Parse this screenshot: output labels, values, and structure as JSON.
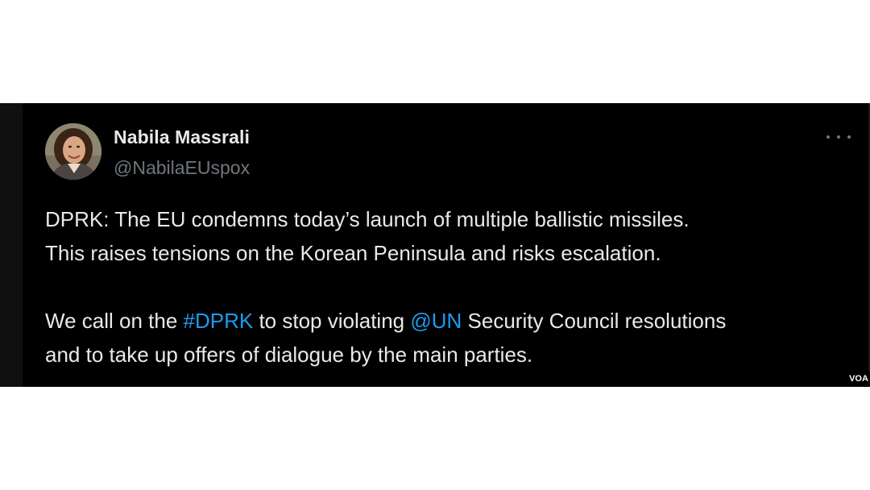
{
  "author": {
    "display_name": "Nabila Massrali",
    "handle": "@NabilaEUspox",
    "avatar_icon": "profile-photo"
  },
  "menu": {
    "icon": "more-horizontal-icon"
  },
  "tweet": {
    "line1": "DPRK: The EU condemns today’s launch of multiple ballistic missiles.",
    "line2": "This raises tensions on the Korean Peninsula and risks escalation.",
    "line3_part1": "We call on the ",
    "hashtag": "#DPRK",
    "line3_part2": " to stop violating ",
    "mention": "@UN",
    "line3_part3": " Security Council resolutions",
    "line4": "and to take up offers of dialogue by the main parties."
  },
  "watermark": {
    "label": "VOA"
  },
  "colors": {
    "background": "#000000",
    "text": "#e7e9ea",
    "secondary_text": "#71767b",
    "link": "#1d9bf0"
  }
}
